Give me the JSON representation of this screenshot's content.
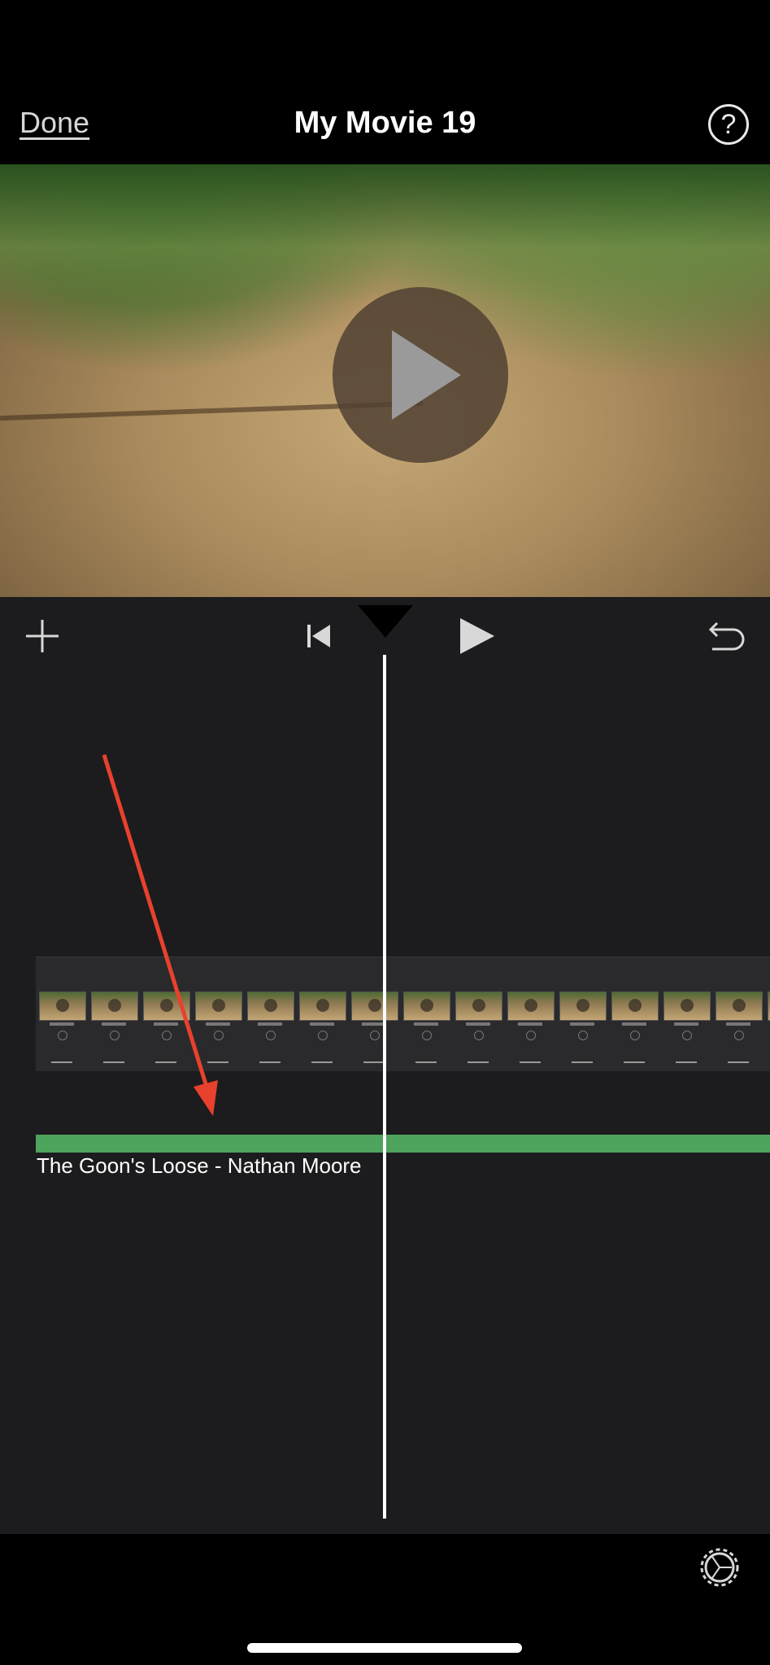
{
  "nav": {
    "done_label": "Done",
    "title": "My Movie 19",
    "help_symbol": "?"
  },
  "timeline": {
    "audio_track_label": "The Goon's Loose - Nathan Moore"
  },
  "colors": {
    "background": "#000000",
    "editor_bg": "#1c1c1e",
    "audio_track": "#4ea35d",
    "annotation_arrow": "#e8412d"
  },
  "icons": {
    "add": "add-icon",
    "skip_back": "skip-back-icon",
    "play": "play-icon",
    "undo": "undo-icon",
    "settings": "gear-icon",
    "preview_play": "play-icon"
  }
}
